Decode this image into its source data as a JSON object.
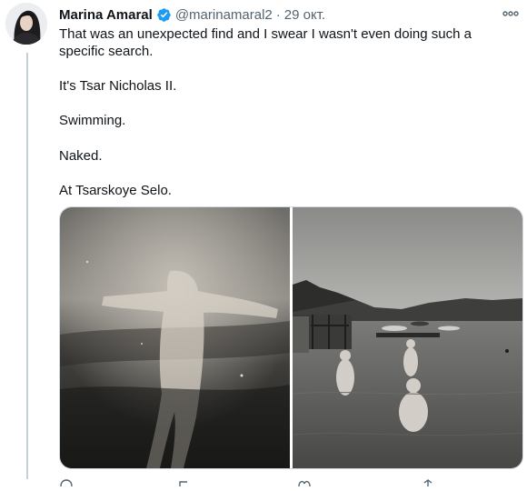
{
  "tweet": {
    "author": {
      "name": "Marina Amaral",
      "handle": "@marinamaral2",
      "verified": true,
      "avatar_icon": "profile-photo"
    },
    "separator": "·",
    "date": "29 окт.",
    "more_icon": "more-horizontal-icon",
    "text": {
      "p1": "That was an unexpected find and I swear I wasn't even doing such a specific search.",
      "p2": "It's Tsar Nicholas II.",
      "p3": "Swimming.",
      "p4": "Naked.",
      "p5": "At Tsarskoye Selo."
    },
    "media": [
      {
        "kind": "photo",
        "tone": "sepia-grayscale",
        "icon": "photo-left"
      },
      {
        "kind": "photo",
        "tone": "grayscale",
        "icon": "photo-right"
      }
    ]
  },
  "colors": {
    "text": "#0f1419",
    "secondary": "#536471",
    "verified": "#1d9bf0",
    "border": "#cfd9de",
    "thread_line": "#c4cfd6"
  }
}
